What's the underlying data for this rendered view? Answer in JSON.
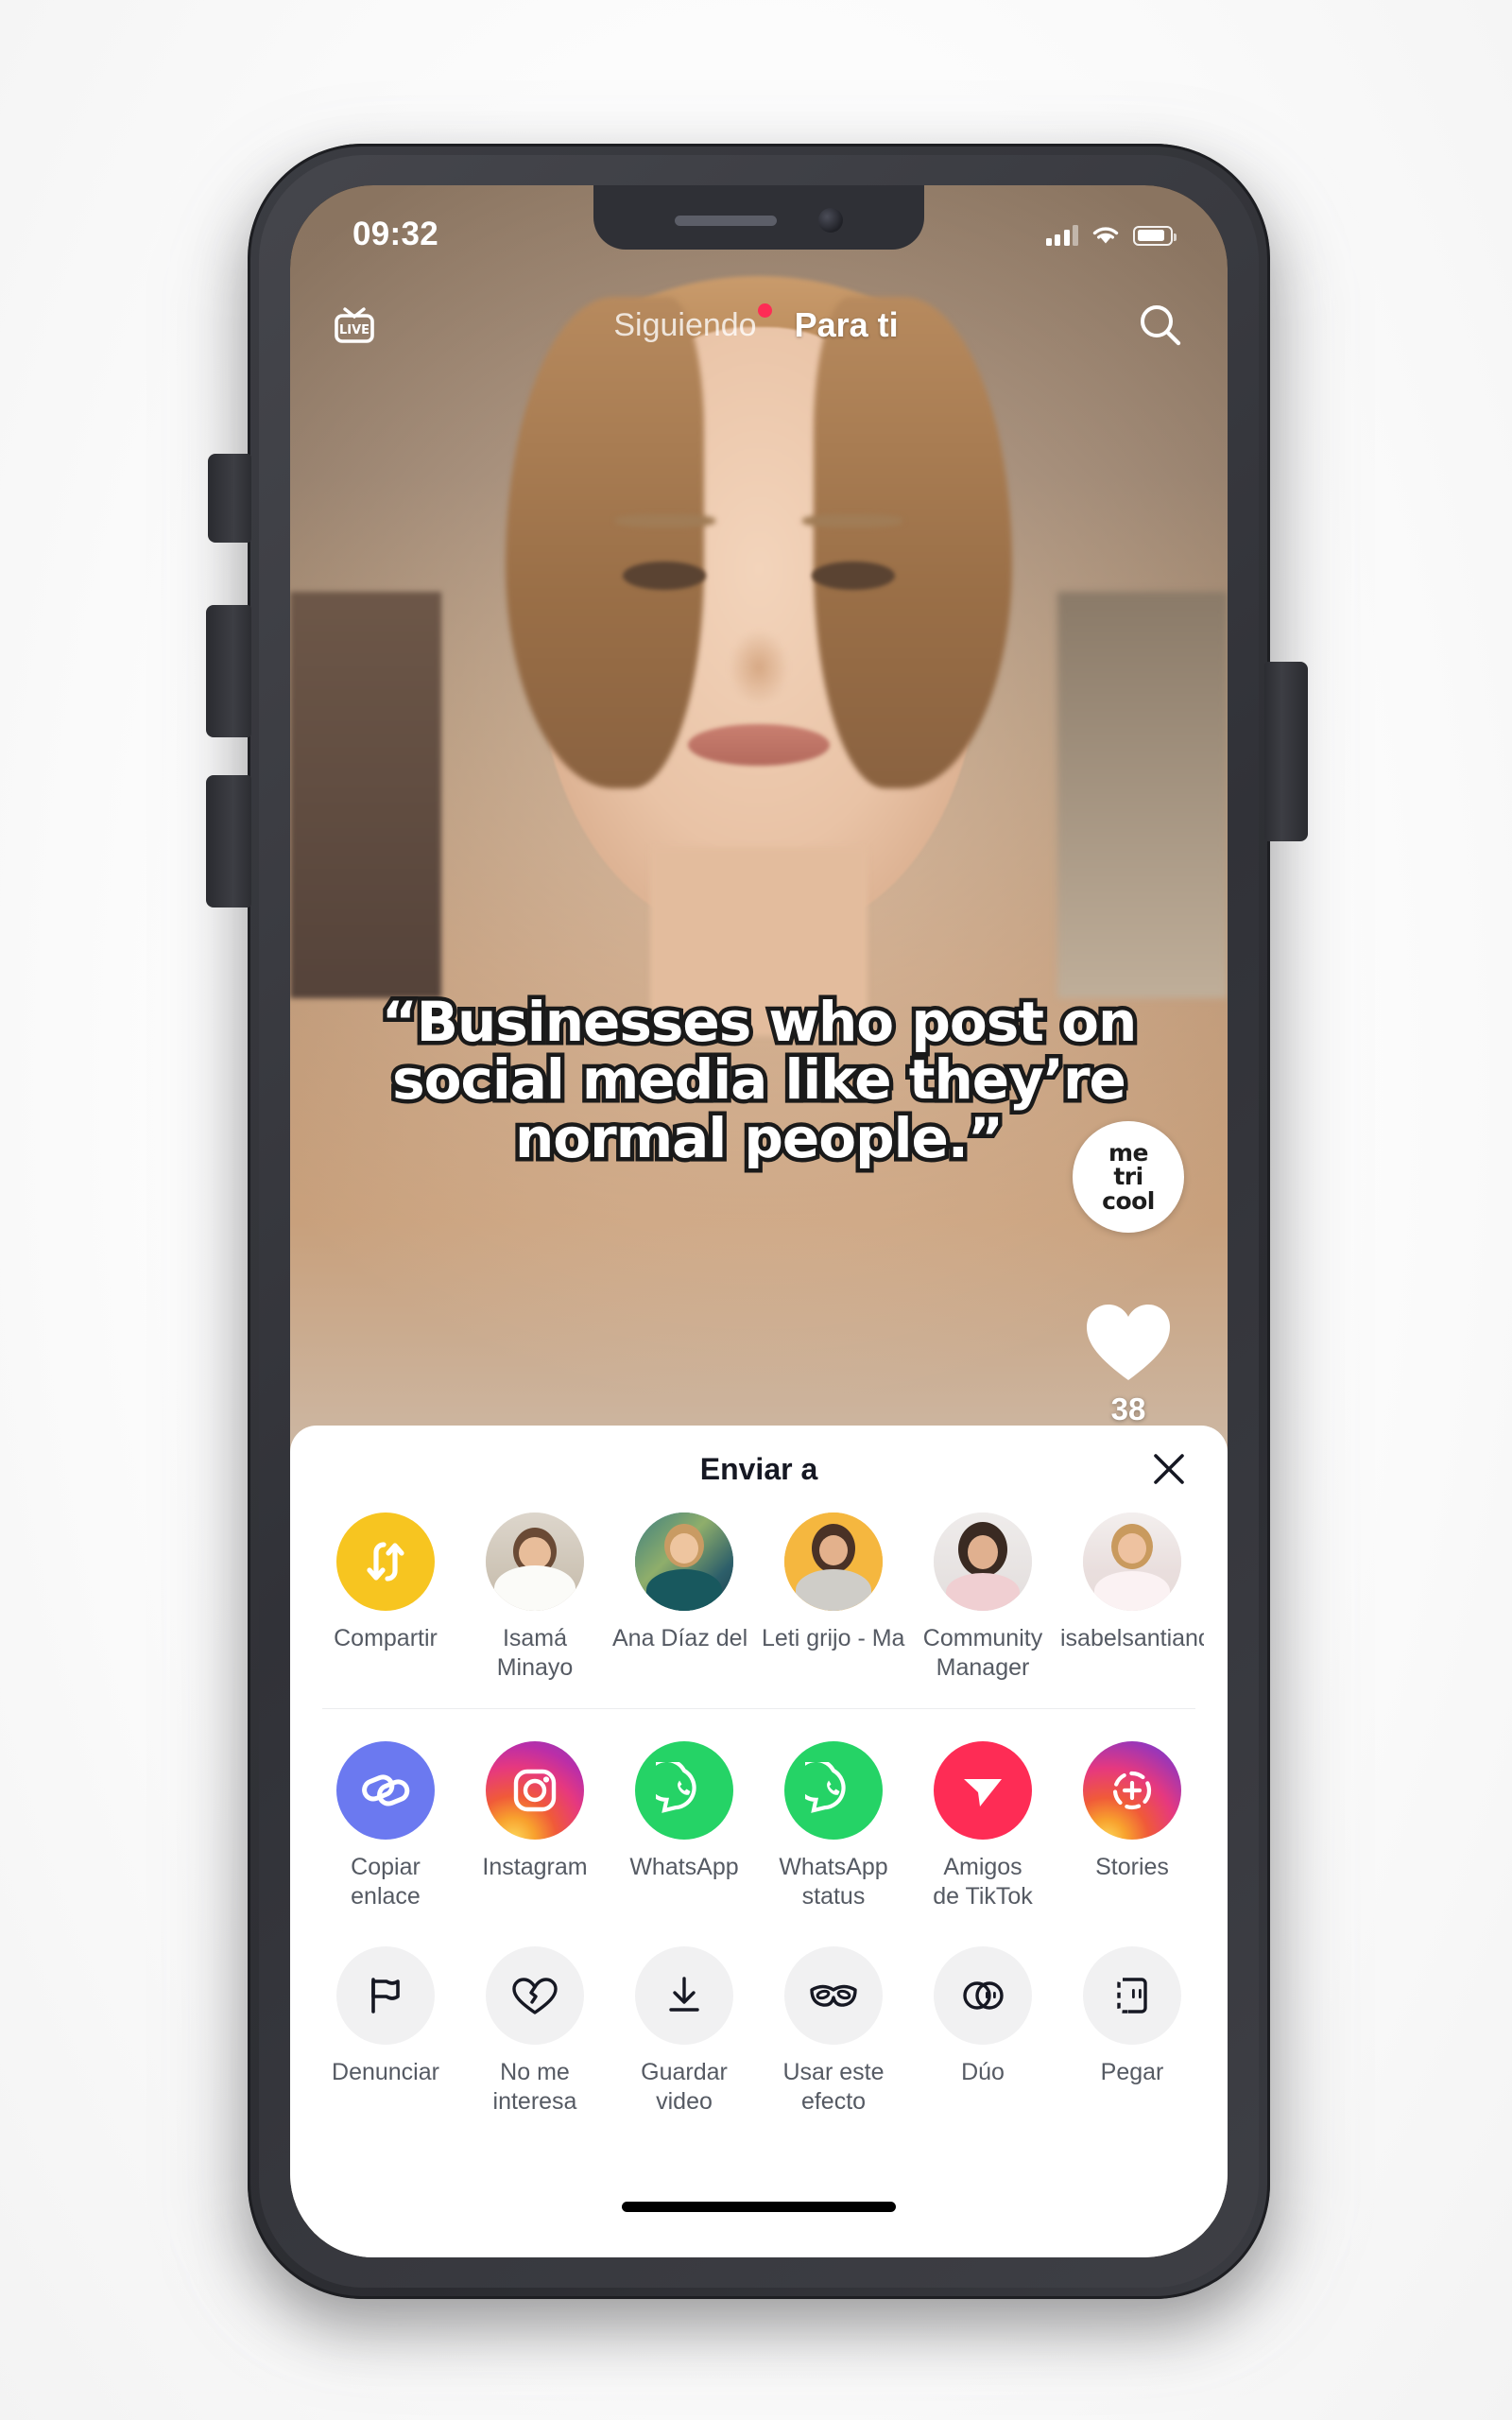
{
  "status_bar": {
    "time": "09:32",
    "signal_icon": "cellular-bars-icon",
    "wifi_icon": "wifi-icon",
    "battery_icon": "battery-icon"
  },
  "top_nav": {
    "live_label": "LIVE",
    "tabs": [
      {
        "label": "Siguiendo",
        "active": false,
        "has_dot": true
      },
      {
        "label": "Para ti",
        "active": true,
        "has_dot": false
      }
    ],
    "search_icon": "search-icon"
  },
  "video": {
    "caption_lines": [
      "“Businesses who post on",
      "social media like they’re",
      "normal people.”"
    ],
    "brand_avatar_lines": [
      "me",
      "tri",
      "cool"
    ],
    "like_count": "38",
    "like_icon": "heart-icon"
  },
  "share_sheet": {
    "title": "Enviar a",
    "close_icon": "close-icon",
    "contacts": [
      {
        "label": "Compartir",
        "icon": "repost-arrows-icon",
        "kind": "share-yellow"
      },
      {
        "label": "Isamá\nMinayo",
        "icon": "avatar",
        "kind": "photo-1"
      },
      {
        "label": "Ana Díaz del\nRío|Negoci…",
        "icon": "avatar",
        "kind": "photo-2"
      },
      {
        "label": "Leti grijo -\nMarketing…",
        "icon": "avatar",
        "kind": "photo-3"
      },
      {
        "label": "Community\nManager",
        "icon": "avatar",
        "kind": "photo-4"
      },
      {
        "label": "isabelsantiandreu",
        "icon": "avatar",
        "kind": "photo-5"
      }
    ],
    "apps": [
      {
        "label": "Copiar\nenlace",
        "icon": "link-icon",
        "kind": "copy-blue"
      },
      {
        "label": "Instagram",
        "icon": "instagram-icon",
        "kind": "ig"
      },
      {
        "label": "WhatsApp",
        "icon": "whatsapp-icon",
        "kind": "wa"
      },
      {
        "label": "WhatsApp\nstatus",
        "icon": "whatsapp-icon",
        "kind": "wa"
      },
      {
        "label": "Amigos\nde TikTok",
        "icon": "paper-plane-icon",
        "kind": "tiktok-friends"
      },
      {
        "label": "Stories",
        "icon": "add-story-icon",
        "kind": "stories"
      }
    ],
    "actions": [
      {
        "label": "Denunciar",
        "icon": "flag-icon",
        "kind": "grey"
      },
      {
        "label": "No me\ninteresa",
        "icon": "broken-heart-icon",
        "kind": "grey"
      },
      {
        "label": "Guardar\nvideo",
        "icon": "download-icon",
        "kind": "grey"
      },
      {
        "label": "Usar este\nefecto",
        "icon": "mask-icon",
        "kind": "grey"
      },
      {
        "label": "Dúo",
        "icon": "duet-icon",
        "kind": "grey"
      },
      {
        "label": "Pegar",
        "icon": "stitch-icon",
        "kind": "grey"
      }
    ]
  },
  "colors": {
    "accent_red": "#fe2c55",
    "share_yellow": "#f7c520",
    "whatsapp_green": "#25d366",
    "copy_blue": "#6b79f0",
    "text_dark": "#161823",
    "label_grey": "#555a63"
  }
}
